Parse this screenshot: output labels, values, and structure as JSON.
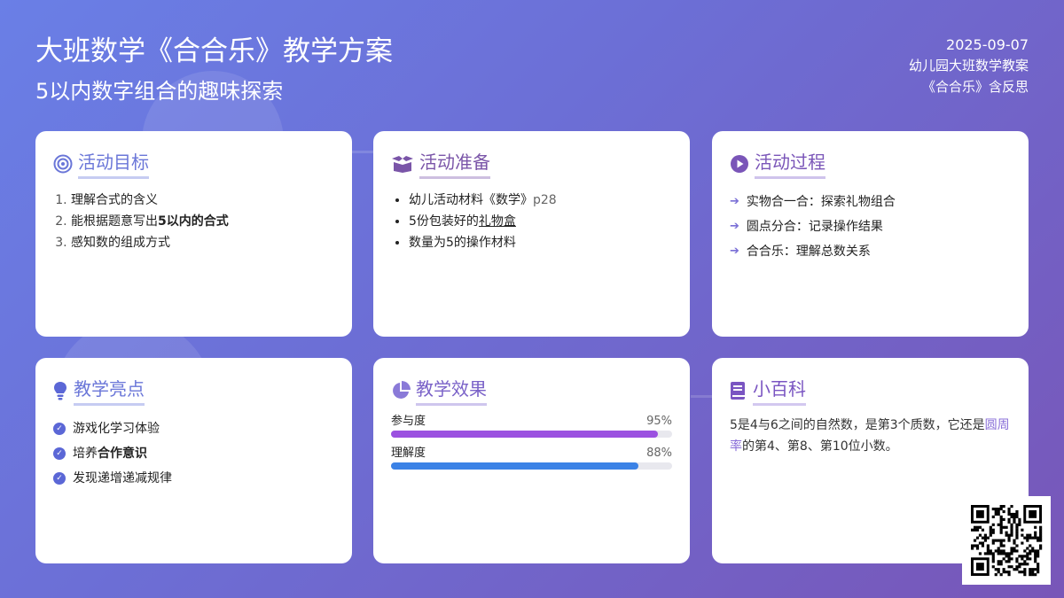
{
  "header": {
    "title": "大班数学《合合乐》教学方案",
    "subtitle": "5以内数字组合的趣味探索",
    "date": "2025-09-07",
    "meta1": "幼儿园大班数学教案",
    "meta2": "《合合乐》含反思"
  },
  "cards": {
    "goals": {
      "title": "活动目标",
      "items": [
        "理解合式的含义",
        "能根据题意写出",
        "感知数的组成方式"
      ],
      "bold2": "5以内的合式"
    },
    "prep": {
      "title": "活动准备",
      "item1": "幼儿活动材料《数学》",
      "item1_page": "p28",
      "item2a": "5份包装好的",
      "item2b": "礼物盒",
      "item3": "数量为5的操作材料"
    },
    "process": {
      "title": "活动过程",
      "items": [
        "实物合一合：探索礼物组合",
        "圆点分合：记录操作结果",
        "合合乐：理解总数关系"
      ]
    },
    "highlights": {
      "title": "教学亮点",
      "item1": "游戏化学习体验",
      "item2a": "培养",
      "item2b": "合作意识",
      "item3": "发现递增递减规律"
    },
    "effect": {
      "title": "教学效果",
      "bars": [
        {
          "label": "参与度",
          "percent": 95,
          "color": "#9b51e0"
        },
        {
          "label": "理解度",
          "percent": 88,
          "color": "#3b82e6"
        }
      ]
    },
    "wiki": {
      "title": "小百科",
      "text_a": "5是4与6之间的自然数，是第3个质数，它还是",
      "link": "圆周率",
      "text_b": "的第4、第8、第10位小数。"
    }
  }
}
